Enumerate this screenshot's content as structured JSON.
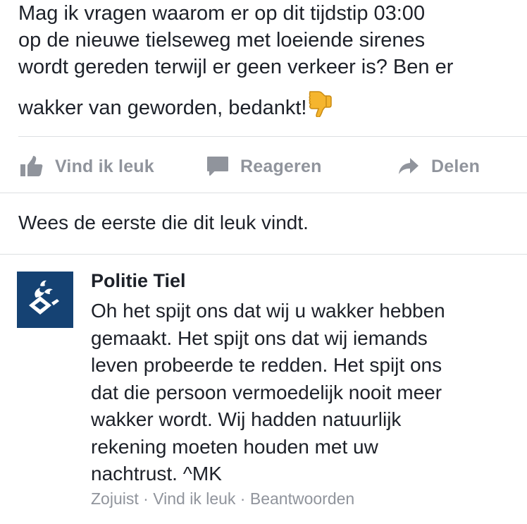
{
  "post": {
    "text_lines": [
      "Mag ik vragen waarom er op dit tijdstip 03:00",
      "op de nieuwe tielseweg met loeiende sirenes",
      "wordt gereden terwijl er geen verkeer is? Ben er",
      "wakker van geworden, bedankt!"
    ],
    "emoji": "thumbs-down-emoji"
  },
  "actions": {
    "like_label": "Vind ik leuk",
    "comment_label": "Reageren",
    "share_label": "Delen",
    "like_icon": "thumbs-up-icon",
    "comment_icon": "speech-bubble-icon",
    "share_icon": "share-arrow-icon"
  },
  "likes_summary": "Wees de eerste die dit leuk vindt.",
  "comment": {
    "author": "Politie Tiel",
    "avatar": "police-logo-icon",
    "avatar_color": "#154273",
    "text_lines": [
      "Oh het spijt ons dat wij u wakker hebben",
      "gemaakt. Het spijt ons dat wij iemands",
      "leven probeerde te redden. Het spijt ons",
      "dat die persoon vermoedelijk nooit meer",
      "wakker wordt. Wij hadden natuurlijk",
      "rekening moeten houden met uw",
      "nachtrust. ^MK"
    ],
    "time": "Zojuist",
    "separator": " · ",
    "like_link": "Vind ik leuk",
    "reply_link": "Beantwoorden"
  },
  "colors": {
    "text": "#1d2129",
    "secondary": "#90949c",
    "divider": "#dddfe2",
    "emoji": "#f5b52e"
  }
}
